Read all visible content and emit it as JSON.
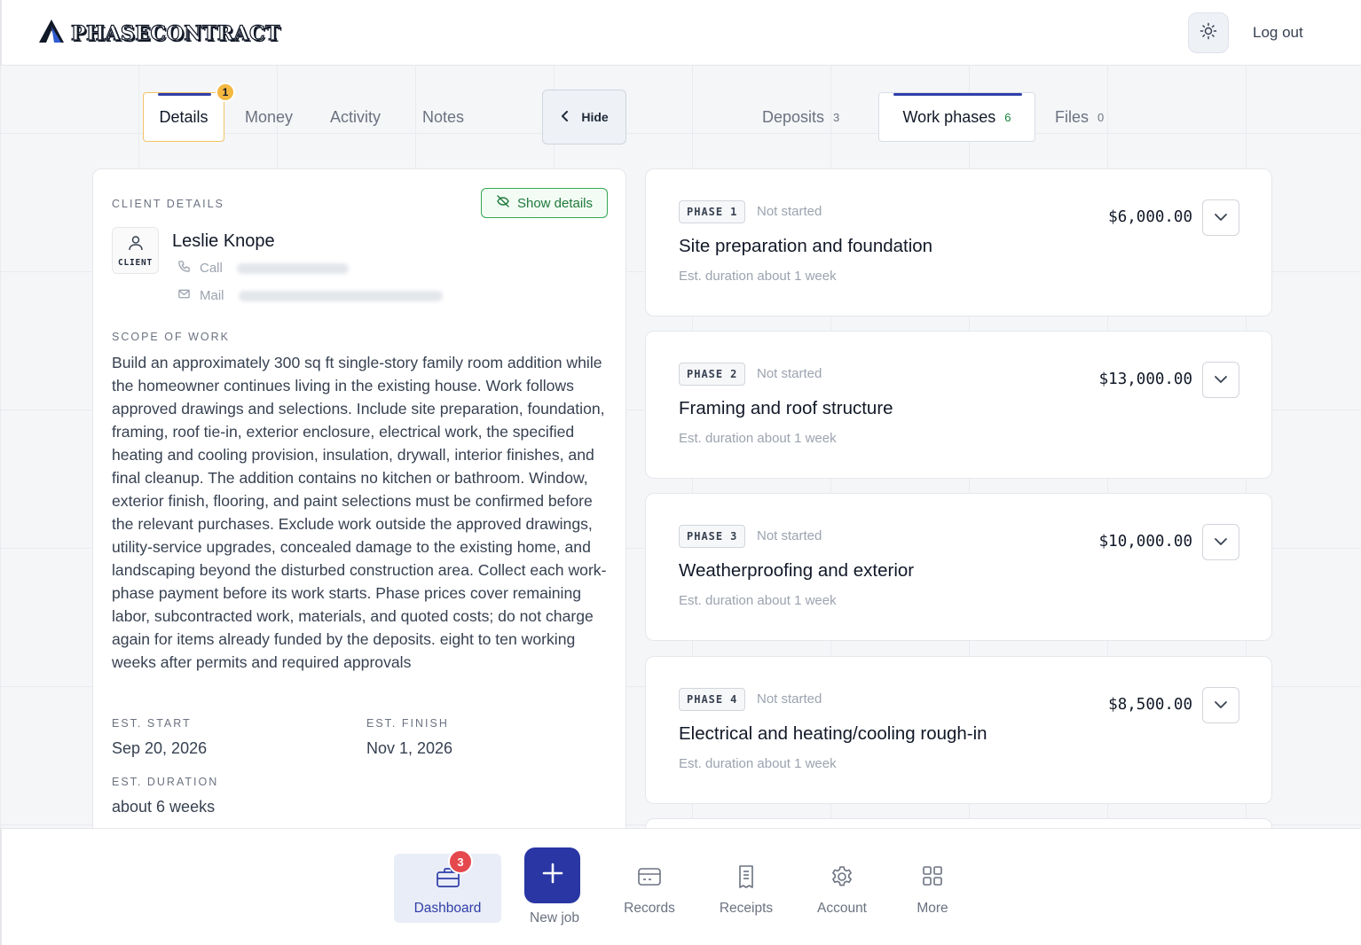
{
  "header": {
    "brand": "PHASECONTRACT",
    "logout_label": "Log out",
    "theme_icon": "sun-icon"
  },
  "tabs_left": [
    {
      "label": "Details",
      "active": true,
      "badge": "1"
    },
    {
      "label": "Money"
    },
    {
      "label": "Activity"
    },
    {
      "label": "Notes"
    }
  ],
  "hide_label": "Hide",
  "tabs_right": [
    {
      "label": "Deposits",
      "count": "3"
    },
    {
      "label": "Work phases",
      "count": "6",
      "active": true
    },
    {
      "label": "Files",
      "count": "0"
    }
  ],
  "client": {
    "section_label": "CLIENT DETAILS",
    "show_details_label": "Show details",
    "avatar_label": "CLIENT",
    "name": "Leslie Knope",
    "call_label": "Call",
    "mail_label": "Mail"
  },
  "scope": {
    "label": "SCOPE OF WORK",
    "text": "Build an approximately 300 sq ft single-story family room addition while the homeowner continues living in the existing house. Work follows approved drawings and selections. Include site preparation, foundation, framing, roof tie-in, exterior enclosure, electrical work, the specified heating and cooling provision, insulation, drywall, interior finishes, and final cleanup. The addition contains no kitchen or bathroom. Window, exterior finish, flooring, and paint selections must be confirmed before the relevant purchases. Exclude work outside the approved drawings, utility-service upgrades, concealed damage to the existing home, and landscaping beyond the disturbed construction area. Collect each work-phase payment before its work starts. Phase prices cover remaining labor, subcontracted work, materials, and quoted costs; do not charge again for items already funded by the deposits. eight to ten working weeks after permits and required approvals"
  },
  "dates": {
    "start_label": "EST. START",
    "start_value": "Sep 20, 2026",
    "finish_label": "EST. FINISH",
    "finish_value": "Nov 1, 2026",
    "duration_label": "EST. DURATION",
    "duration_value": "about 6 weeks"
  },
  "phases": [
    {
      "tag": "PHASE",
      "num": "1",
      "status": "Not started",
      "title": "Site preparation and foundation",
      "duration": "Est. duration about 1 week",
      "price": "$6,000.00"
    },
    {
      "tag": "PHASE",
      "num": "2",
      "status": "Not started",
      "title": "Framing and roof structure",
      "duration": "Est. duration about 1 week",
      "price": "$13,000.00"
    },
    {
      "tag": "PHASE",
      "num": "3",
      "status": "Not started",
      "title": "Weatherproofing and exterior",
      "duration": "Est. duration about 1 week",
      "price": "$10,000.00"
    },
    {
      "tag": "PHASE",
      "num": "4",
      "status": "Not started",
      "title": "Electrical and heating/cooling rough-in",
      "duration": "Est. duration about 1 week",
      "price": "$8,500.00"
    }
  ],
  "bottom_nav": [
    {
      "label": "Dashboard",
      "icon": "briefcase-icon",
      "badge": "3",
      "active": true
    },
    {
      "label": "New job",
      "icon": "plus-icon"
    },
    {
      "label": "Records",
      "icon": "card-icon"
    },
    {
      "label": "Receipts",
      "icon": "receipt-icon"
    },
    {
      "label": "Account",
      "icon": "gear-icon"
    },
    {
      "label": "More",
      "icon": "grid-icon"
    }
  ],
  "colors": {
    "accent": "#2f3ea8",
    "primary_button": "#2936a3",
    "badge_yellow": "#f4b740",
    "badge_red": "#e5484d",
    "success_green": "#34a853"
  }
}
